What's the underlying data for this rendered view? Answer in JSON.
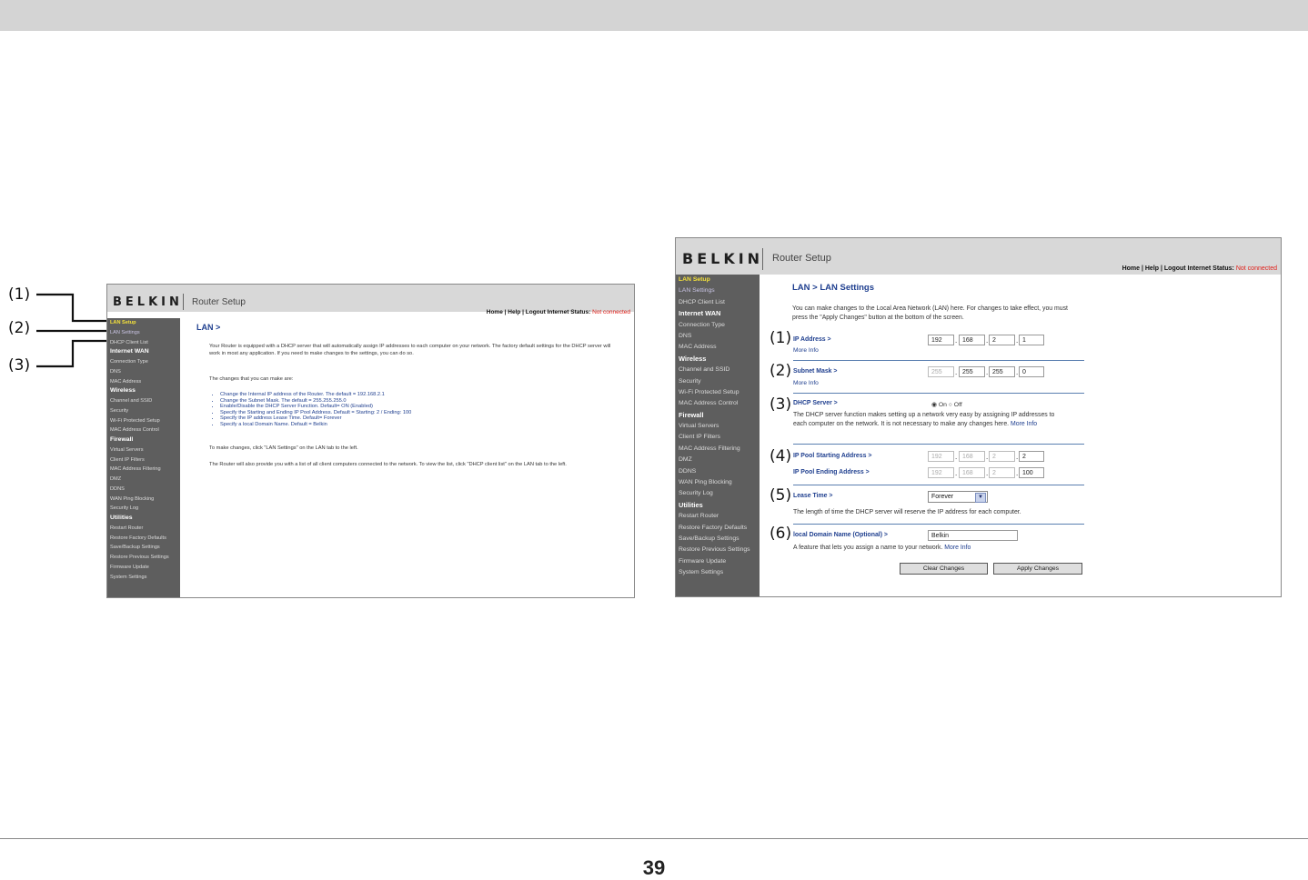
{
  "page_number": "39",
  "callouts_left": [
    "(1)",
    "(2)",
    "(3)"
  ],
  "shot_a": {
    "logo": "BELKIN",
    "product": "Router Setup",
    "toplinks": "Home | Help | Logout   Internet Status:",
    "status": "Not connected",
    "title": "LAN >",
    "side": [
      {
        "t": "LAN Setup",
        "k": "act"
      },
      {
        "t": "LAN Settings",
        "k": "sub"
      },
      {
        "t": "DHCP Client List",
        "k": "sub"
      },
      {
        "t": "Internet WAN",
        "k": "sec"
      },
      {
        "t": "Connection Type",
        "k": "sub"
      },
      {
        "t": "DNS",
        "k": "sub"
      },
      {
        "t": "MAC Address",
        "k": "sub"
      },
      {
        "t": "Wireless",
        "k": "sec"
      },
      {
        "t": "Channel and SSID",
        "k": "sub"
      },
      {
        "t": "Security",
        "k": "sub"
      },
      {
        "t": "Wi-Fi Protected Setup",
        "k": "sub"
      },
      {
        "t": "MAC Address Control",
        "k": "sub"
      },
      {
        "t": "Firewall",
        "k": "sec"
      },
      {
        "t": "Virtual Servers",
        "k": "sub"
      },
      {
        "t": "Client IP Filters",
        "k": "sub"
      },
      {
        "t": "MAC Address Filtering",
        "k": "sub"
      },
      {
        "t": "DMZ",
        "k": "sub"
      },
      {
        "t": "DDNS",
        "k": "sub"
      },
      {
        "t": "WAN Ping Blocking",
        "k": "sub"
      },
      {
        "t": "Security Log",
        "k": "sub"
      },
      {
        "t": "Utilities",
        "k": "sec"
      },
      {
        "t": "Restart Router",
        "k": "sub"
      },
      {
        "t": "Restore Factory Defaults",
        "k": "sub"
      },
      {
        "t": "Save/Backup Settings",
        "k": "sub"
      },
      {
        "t": "Restore Previous Settings",
        "k": "sub"
      },
      {
        "t": "Firmware Update",
        "k": "sub"
      },
      {
        "t": "System Settings",
        "k": "sub"
      }
    ],
    "p1": "Your Router is equipped with a DHCP server that will automatically assign IP addresses to each computer on your network. The factory default settings for the DHCP server will work in most any application. If you need to make changes to the settings, you can do so.",
    "p2": "The changes that you can make are:",
    "bullets": [
      "Change the Internal IP address of the Router. The default = 192.168.2.1",
      "Change the Subnet Mask. The default = 255.255.255.0",
      "Enable/Disable the DHCP Server Function. Default= ON (Enabled)",
      "Specify the Starting and Ending IP Pool Address. Default = Starting: 2 / Ending: 100",
      "Specify the IP address Lease Time. Default= Forever",
      "Specify a local Domain Name. Default = Belkin"
    ],
    "p3": "To make changes, click \"LAN Settings\" on the LAN tab to the left.",
    "p4": "The Router will also provide you with a list of all client computers connected to the network. To view the list, click \"DHCP client list\" on the LAN tab to the left."
  },
  "shot_b": {
    "logo": "BELKIN",
    "product": "Router Setup",
    "toplinks": "Home | Help | Logout   Internet Status:",
    "status": "Not connected",
    "title": "LAN > LAN Settings",
    "intro": "You can make changes to the Local Area Network (LAN) here. For changes to take effect, you must press the \"Apply Changes\" button at the bottom of the screen.",
    "callouts": [
      "(1)",
      "(2)",
      "(3)",
      "(4)",
      "(5)",
      "(6)"
    ],
    "ip_label": "IP Address >",
    "ip": [
      "192",
      "168",
      "2",
      "1"
    ],
    "more_info": "More Info",
    "subnet_label": "Subnet Mask >",
    "subnet": [
      "255",
      "255",
      "255",
      "0"
    ],
    "dhcp_label": "DHCP Server >",
    "dhcp_on": "On",
    "dhcp_off": "Off",
    "dhcp_desc": "The DHCP server function makes setting up a network very easy by assigning IP addresses to each computer on the network. It is not necessary to make any changes here.",
    "pool_start_label": "IP Pool Starting Address >",
    "pool_start": [
      "192",
      "168",
      "2",
      "2"
    ],
    "pool_end_label": "IP Pool Ending Address >",
    "pool_end": [
      "192",
      "168",
      "2",
      "100"
    ],
    "lease_label": "Lease Time >",
    "lease_value": "Forever",
    "lease_desc": "The length of time the DHCP server will reserve the IP address for each computer.",
    "domain_label": "local Domain Name  (Optional) >",
    "domain_value": "Belkin",
    "domain_desc": "A feature that lets you assign a name to your network.",
    "btn_clear": "Clear Changes",
    "btn_apply": "Apply Changes"
  }
}
